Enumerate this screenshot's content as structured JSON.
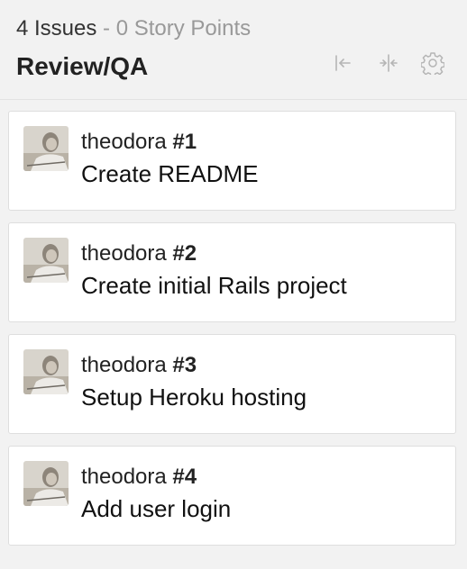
{
  "column": {
    "issue_count": "4 Issues",
    "separator": " - ",
    "story_points": "0 Story Points",
    "title": "Review/QA",
    "icons": [
      "collapse-left-icon",
      "collapse-icon",
      "gear-icon"
    ]
  },
  "cards": [
    {
      "assignee": "theodora",
      "number": "#1",
      "title": "Create README"
    },
    {
      "assignee": "theodora",
      "number": "#2",
      "title": "Create initial Rails project"
    },
    {
      "assignee": "theodora",
      "number": "#3",
      "title": "Setup Heroku hosting"
    },
    {
      "assignee": "theodora",
      "number": "#4",
      "title": "Add user login"
    }
  ],
  "colors": {
    "background": "#f2f2f2",
    "card": "#ffffff",
    "muted_text": "#999999",
    "icon": "#b5b5b5"
  }
}
